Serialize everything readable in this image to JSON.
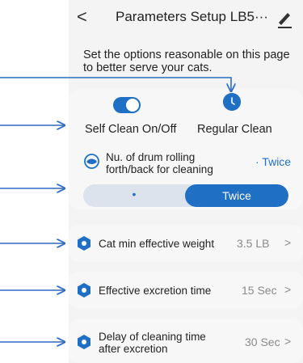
{
  "header": {
    "back_icon": "chevron-left-icon",
    "title": "Parameters Setup LB5···",
    "edit_icon": "edit-pencil-icon"
  },
  "description": "Set the options reasonable on this page to better serve your cats.",
  "options": {
    "self_clean_label": "Self Clean On/Off",
    "self_clean_enabled": true,
    "regular_clean_label": "Regular Clean"
  },
  "drum": {
    "label": "Nu. of drum rolling forth/back for cleaning",
    "value": "· Twice",
    "segments": [
      "•",
      "Twice"
    ],
    "selected": "Twice"
  },
  "rows": [
    {
      "label": "Cat min effective weight",
      "value": "3.5 LB"
    },
    {
      "label": "Effective excretion time",
      "value": "15 Sec"
    },
    {
      "label": "Delay of cleaning time after excretion",
      "value": "30 Sec"
    }
  ],
  "colors": {
    "accent": "#1f6fc5",
    "panel": "#f4f4f4",
    "arrow": "#2b6cc4"
  }
}
